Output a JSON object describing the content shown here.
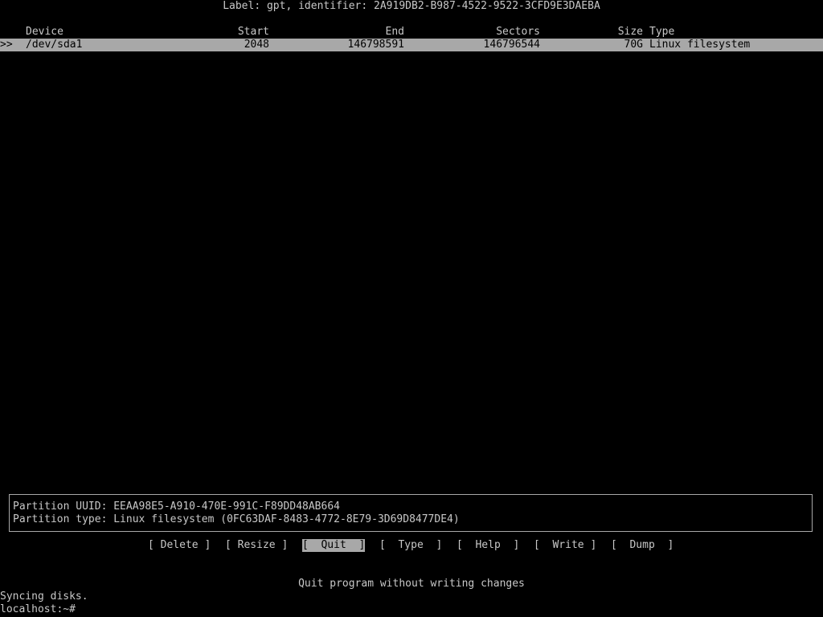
{
  "header": {
    "label": "Label: gpt, identifier: 2A919DB2-B987-4522-9522-3CFD9E3DAEBA"
  },
  "table": {
    "columns": {
      "device": "Device",
      "start": "Start",
      "end": "End",
      "sectors": "Sectors",
      "size": "Size",
      "type": "Type"
    },
    "rows": [
      {
        "marker": ">>",
        "device": "/dev/sda1",
        "start": "2048",
        "end": "146798591",
        "sectors": "146796544",
        "size": "70G",
        "type": "Linux filesystem"
      }
    ]
  },
  "info": {
    "uuid": "Partition UUID: EEAA98E5-A910-470E-991C-F89DD48AB664",
    "type": "Partition type: Linux filesystem (0FC63DAF-8483-4772-8E79-3D69D8477DE4)"
  },
  "menu": {
    "delete": "[ Delete ]",
    "resize": "[ Resize ]",
    "quit": "[  Quit  ]",
    "type": "[  Type  ]",
    "help": "[  Help  ]",
    "write": "[  Write ]",
    "dump": "[  Dump  ]",
    "selected": "quit"
  },
  "hint": "Quit program without writing changes",
  "shell": {
    "line1": "Syncing disks.",
    "line2": "localhost:~#"
  }
}
